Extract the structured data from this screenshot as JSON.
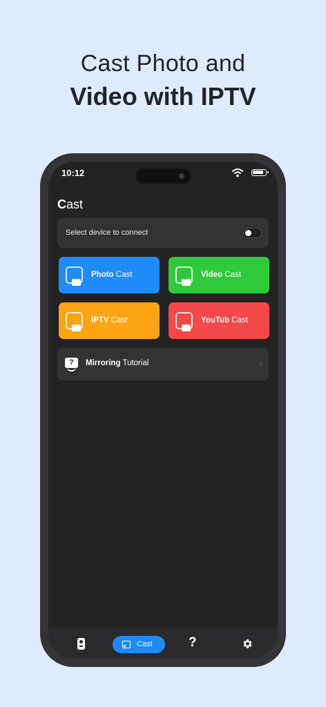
{
  "headline": {
    "line1": "Cast Photo and",
    "line2": "Video with IPTV"
  },
  "status_bar": {
    "time": "10:12",
    "wifi_icon": "wifi-icon",
    "battery_icon": "battery-icon"
  },
  "app": {
    "title_first_letter": "C",
    "title_rest": "ast"
  },
  "device_selector": {
    "label": "Select device to connect",
    "toggle_on": false
  },
  "tiles": [
    {
      "bold": "Photo",
      "rest": " Cast",
      "color": "#1e8bf6",
      "icon": "photo-icon"
    },
    {
      "bold": "Video",
      "rest": " Cast",
      "color": "#2fca3b",
      "icon": "video-icon"
    },
    {
      "bold": "IPTV",
      "rest": " Cast",
      "color": "#fca412",
      "icon": "tv-icon"
    },
    {
      "bold": "YouTub",
      "rest": " Cast",
      "color": "#f54848",
      "icon": "youtube-icon"
    }
  ],
  "tutorial": {
    "bold": "Mirroring",
    "rest": " Tutorial",
    "icon": "question-icon",
    "chevron": "›"
  },
  "bottom_nav": {
    "items": [
      {
        "icon": "remote-icon"
      },
      {
        "icon": "cast-icon",
        "label": "Cast",
        "active": true
      },
      {
        "icon": "help-icon",
        "glyph": "?"
      },
      {
        "icon": "gear-icon"
      }
    ]
  },
  "colors": {
    "background": "#dfeafc",
    "screen": "#232323",
    "accent": "#1e8bf6"
  }
}
